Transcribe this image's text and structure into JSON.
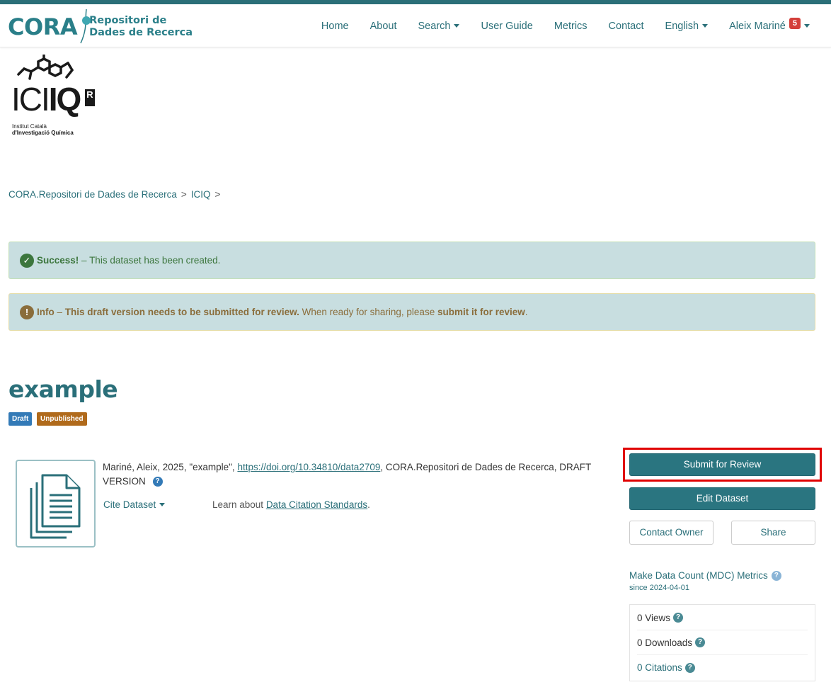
{
  "header": {
    "logo_text": "CORA",
    "subtitle_line1": "Repositori de",
    "subtitle_line2": "Dades de Recerca",
    "nav": {
      "home": "Home",
      "about": "About",
      "search": "Search",
      "user_guide": "User Guide",
      "metrics": "Metrics",
      "contact": "Contact",
      "language": "English",
      "user": "Aleix Mariné",
      "notifications": "5"
    },
    "accent_color": "#2b6f78"
  },
  "institution": {
    "logo_big_light": "ICI",
    "logo_big_bold": "IQ",
    "logo_r": "R",
    "logo_small_line1": "Institut Català",
    "logo_small_line2": "d'Investigació Química"
  },
  "breadcrumb": {
    "items": [
      "CORA.Repositori de Dades de Recerca",
      "ICIQ"
    ],
    "separator": ">"
  },
  "alerts": {
    "success_label": "Success!",
    "success_text": " – This dataset has been created.",
    "info_label": "Info",
    "info_sep": " – ",
    "info_bold": "This draft version needs to be submitted for review.",
    "info_text": " When ready for sharing, please ",
    "info_link": "submit it for review",
    "info_end": "."
  },
  "dataset": {
    "title": "example",
    "label_draft": "Draft",
    "label_unpublished": "Unpublished",
    "citation_prefix": "Mariné, Aleix, 2025, \"example\", ",
    "doi": "https://doi.org/10.34810/data2709",
    "citation_suffix": ", CORA.Repositori de Dades de Recerca, DRAFT VERSION",
    "cite_button": "Cite Dataset",
    "learn_text": "Learn about ",
    "learn_link": "Data Citation Standards",
    "learn_end": "."
  },
  "actions": {
    "submit": "Submit for Review",
    "edit": "Edit Dataset",
    "contact": "Contact Owner",
    "share": "Share"
  },
  "metrics": {
    "title": "Make Data Count (MDC) Metrics",
    "since": "since 2024-04-01",
    "views": "0 Views",
    "downloads": "0 Downloads",
    "citations": "0 Citations"
  }
}
